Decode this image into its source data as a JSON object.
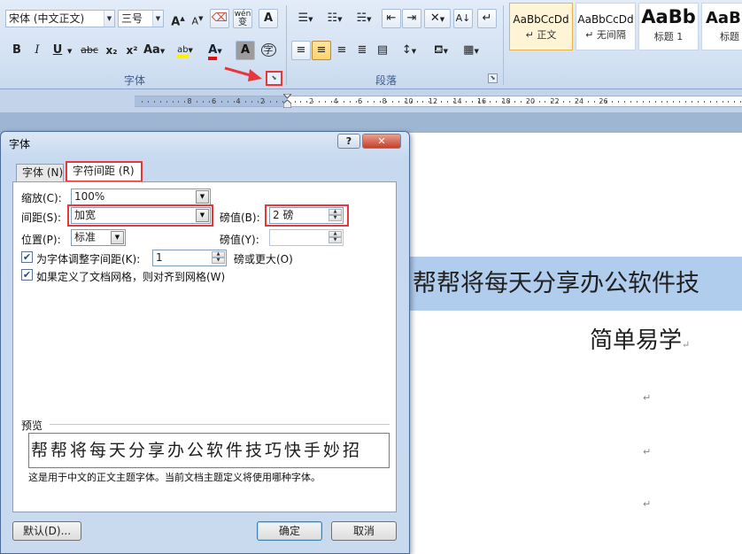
{
  "ribbon": {
    "font_name": "宋体 (中文正文)",
    "font_size": "三号",
    "group_font_label": "字体",
    "group_paragraph_label": "段落",
    "grow_font": "A",
    "shrink_font": "A",
    "clear_format": "A",
    "phonetic_guide": "wén",
    "char_border": "A",
    "bold": "B",
    "italic": "I",
    "underline": "U",
    "strikethrough": "abc",
    "subscript": "x₂",
    "superscript": "x²",
    "change_case": "Aa",
    "highlight": "ab",
    "font_color": "A",
    "char_shading": "A",
    "enclose_char": "字",
    "styles": [
      {
        "sample": "AaBbCcDd",
        "name": "↵ 正文"
      },
      {
        "sample": "AaBbCcDd",
        "name": "↵ 无间隔"
      },
      {
        "sample": "AaBb",
        "name": "标题 1"
      },
      {
        "sample": "AaBl",
        "name": "标题"
      }
    ]
  },
  "ruler": {
    "left_numbers": [
      "8",
      "6",
      "4",
      "2"
    ],
    "right_numbers": [
      "2",
      "4",
      "6",
      "8",
      "10",
      "12",
      "14",
      "16",
      "18",
      "20",
      "22",
      "24",
      "26"
    ]
  },
  "document": {
    "selected_line": "帮帮将每天分享办公软件技",
    "second_line": "简单易学",
    "para_mark": "↵"
  },
  "dialog": {
    "title": "字体",
    "help": "?",
    "close": "✕",
    "tabs": [
      {
        "label": "字体 (N)"
      },
      {
        "label": "字符间距 (R)"
      }
    ],
    "scale_label": "缩放(C):",
    "scale_value": "100%",
    "spacing_label": "间距(S):",
    "spacing_value": "加宽",
    "spacing_pt_label": "磅值(B):",
    "spacing_pt_value": "2 磅",
    "position_label": "位置(P):",
    "position_value": "标准",
    "position_pt_label": "磅值(Y):",
    "position_pt_value": "",
    "kerning_label": "为字体调整字间距(K):",
    "kerning_value": "1",
    "kerning_suffix": "磅或更大(O)",
    "kerning_checked": true,
    "grid_label": "如果定义了文档网格，则对齐到网格(W)",
    "grid_checked": true,
    "preview_label": "预览",
    "preview_text": "帮帮将每天分享办公软件技巧快手妙招",
    "preview_note": "这是用于中文的正文主题字体。当前文档主题定义将使用哪种字体。",
    "default_button": "默认(D)...",
    "ok_button": "确定",
    "cancel_button": "取消"
  },
  "colors": {
    "highlight_box": "#e8373a",
    "selection": "#b1cdee"
  }
}
